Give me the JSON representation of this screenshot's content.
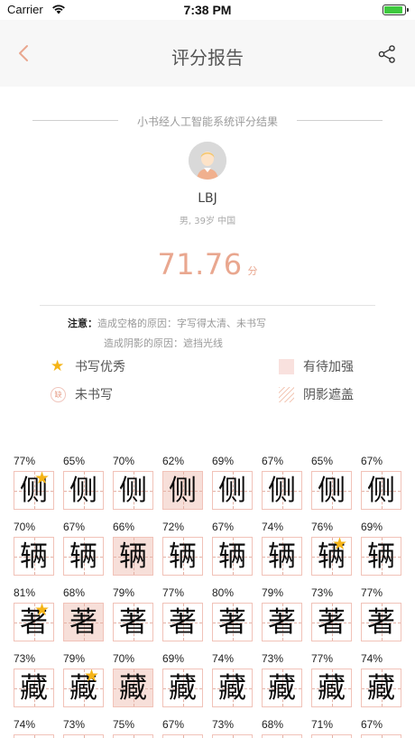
{
  "status_bar": {
    "carrier": "Carrier",
    "time": "7:38 PM",
    "battery_level": 0.92
  },
  "nav": {
    "title": "评分报告"
  },
  "header": {
    "subtitle": "小书经人工智能系统评分结果"
  },
  "user": {
    "name": "LBJ",
    "meta": "男, 39岁 中国"
  },
  "score": {
    "value": "71.76",
    "unit": "分"
  },
  "note": {
    "label": "注意：",
    "line1": "造成空格的原因：字写得太清、未书写",
    "line2": "造成阴影的原因：遮挡光线"
  },
  "legend": {
    "excellent": "书写优秀",
    "needs_improve": "有待加强",
    "missing": "未书写",
    "missing_icon_text": "缺",
    "shadow": "阴影遮盖"
  },
  "colors": {
    "accent": "#e9a78f",
    "star": "#f5b417",
    "weak_bg": "#f7dfd9",
    "grid_line": "#f1c2b8"
  },
  "rows": [
    {
      "char": "侧",
      "cells": [
        {
          "pct": "77%",
          "star": true,
          "weak": false
        },
        {
          "pct": "65%",
          "star": false,
          "weak": false
        },
        {
          "pct": "70%",
          "star": false,
          "weak": false
        },
        {
          "pct": "62%",
          "star": false,
          "weak": true
        },
        {
          "pct": "69%",
          "star": false,
          "weak": false
        },
        {
          "pct": "67%",
          "star": false,
          "weak": false
        },
        {
          "pct": "65%",
          "star": false,
          "weak": false
        },
        {
          "pct": "67%",
          "star": false,
          "weak": false
        }
      ]
    },
    {
      "char": "辆",
      "cells": [
        {
          "pct": "70%",
          "star": false,
          "weak": false
        },
        {
          "pct": "67%",
          "star": false,
          "weak": false
        },
        {
          "pct": "66%",
          "star": false,
          "weak": true
        },
        {
          "pct": "72%",
          "star": false,
          "weak": false
        },
        {
          "pct": "67%",
          "star": false,
          "weak": false
        },
        {
          "pct": "74%",
          "star": false,
          "weak": false
        },
        {
          "pct": "76%",
          "star": true,
          "weak": false
        },
        {
          "pct": "69%",
          "star": false,
          "weak": false
        }
      ]
    },
    {
      "char": "著",
      "cells": [
        {
          "pct": "81%",
          "star": true,
          "weak": false
        },
        {
          "pct": "68%",
          "star": false,
          "weak": true
        },
        {
          "pct": "79%",
          "star": false,
          "weak": false
        },
        {
          "pct": "77%",
          "star": false,
          "weak": false
        },
        {
          "pct": "80%",
          "star": false,
          "weak": false
        },
        {
          "pct": "79%",
          "star": false,
          "weak": false
        },
        {
          "pct": "73%",
          "star": false,
          "weak": false
        },
        {
          "pct": "77%",
          "star": false,
          "weak": false
        }
      ]
    },
    {
      "char": "藏",
      "cells": [
        {
          "pct": "73%",
          "star": false,
          "weak": false
        },
        {
          "pct": "79%",
          "star": true,
          "weak": false
        },
        {
          "pct": "70%",
          "star": false,
          "weak": true
        },
        {
          "pct": "69%",
          "star": false,
          "weak": false
        },
        {
          "pct": "74%",
          "star": false,
          "weak": false
        },
        {
          "pct": "73%",
          "star": false,
          "weak": false
        },
        {
          "pct": "77%",
          "star": false,
          "weak": false
        },
        {
          "pct": "74%",
          "star": false,
          "weak": false
        }
      ]
    },
    {
      "char": "",
      "cells": [
        {
          "pct": "74%",
          "star": false,
          "weak": false
        },
        {
          "pct": "73%",
          "star": false,
          "weak": false
        },
        {
          "pct": "75%",
          "star": false,
          "weak": false
        },
        {
          "pct": "67%",
          "star": false,
          "weak": false
        },
        {
          "pct": "73%",
          "star": false,
          "weak": false
        },
        {
          "pct": "68%",
          "star": false,
          "weak": false
        },
        {
          "pct": "71%",
          "star": false,
          "weak": false
        },
        {
          "pct": "67%",
          "star": false,
          "weak": false
        }
      ]
    }
  ]
}
